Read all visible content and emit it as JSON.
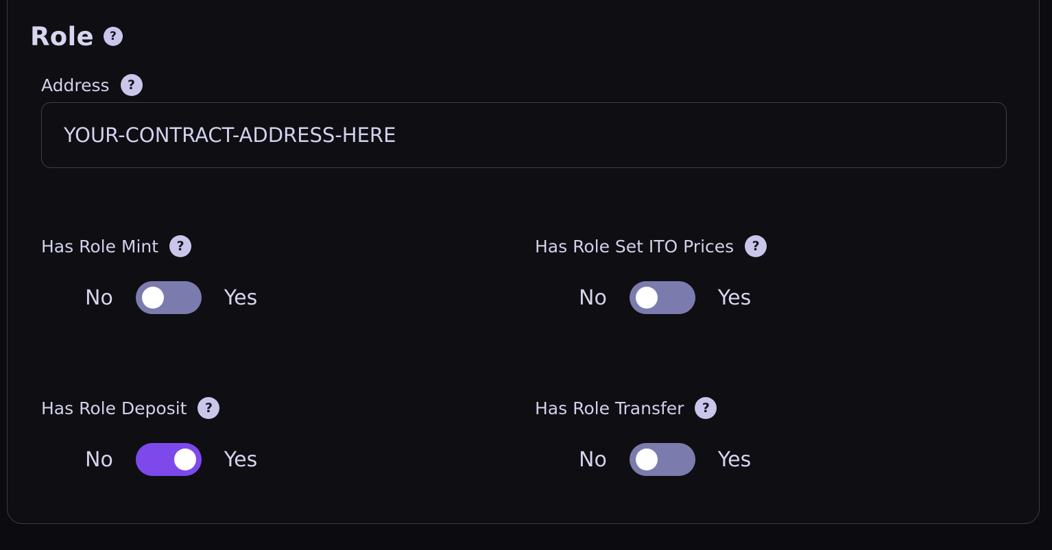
{
  "section": {
    "title": "Role",
    "help_glyph": "?"
  },
  "address": {
    "label": "Address",
    "value": "YOUR-CONTRACT-ADDRESS-HERE",
    "help_glyph": "?"
  },
  "toggles": [
    {
      "label": "Has Role Mint",
      "off_label": "No",
      "on_label": "Yes",
      "checked": false,
      "help_glyph": "?"
    },
    {
      "label": "Has Role Set ITO Prices",
      "off_label": "No",
      "on_label": "Yes",
      "checked": false,
      "help_glyph": "?"
    },
    {
      "label": "Has Role Deposit",
      "off_label": "No",
      "on_label": "Yes",
      "checked": true,
      "help_glyph": "?"
    },
    {
      "label": "Has Role Transfer",
      "off_label": "No",
      "on_label": "Yes",
      "checked": false,
      "help_glyph": "?"
    }
  ],
  "colors": {
    "background": "#0b0b10",
    "toggle_off": "#7b7bae",
    "toggle_on": "#7d49eb",
    "help_icon": "#c9c6ea"
  }
}
